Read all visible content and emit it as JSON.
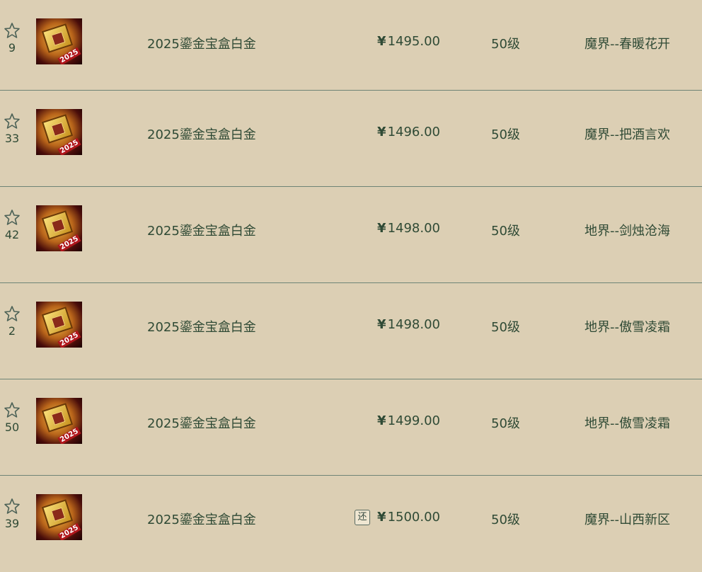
{
  "colors": {
    "background": "#dccfb4",
    "text": "#2f4a35",
    "divider": "#6f8476"
  },
  "listings": [
    {
      "fav_count": "9",
      "name": "2025鎏金宝盒白金",
      "currency": "¥",
      "price": "1495.00",
      "badge": "",
      "level": "50级",
      "server": "魔界--春暖花开",
      "thumb_year": "2025"
    },
    {
      "fav_count": "33",
      "name": "2025鎏金宝盒白金",
      "currency": "¥",
      "price": "1496.00",
      "badge": "",
      "level": "50级",
      "server": "魔界--把酒言欢",
      "thumb_year": "2025"
    },
    {
      "fav_count": "42",
      "name": "2025鎏金宝盒白金",
      "currency": "¥",
      "price": "1498.00",
      "badge": "",
      "level": "50级",
      "server": "地界--剑烛沧海",
      "thumb_year": "2025"
    },
    {
      "fav_count": "2",
      "name": "2025鎏金宝盒白金",
      "currency": "¥",
      "price": "1498.00",
      "badge": "",
      "level": "50级",
      "server": "地界--傲雪凌霜",
      "thumb_year": "2025"
    },
    {
      "fav_count": "50",
      "name": "2025鎏金宝盒白金",
      "currency": "¥",
      "price": "1499.00",
      "badge": "",
      "level": "50级",
      "server": "地界--傲雪凌霜",
      "thumb_year": "2025"
    },
    {
      "fav_count": "39",
      "name": "2025鎏金宝盒白金",
      "currency": "¥",
      "price": "1500.00",
      "badge": "还",
      "level": "50级",
      "server": "魔界--山西新区",
      "thumb_year": "2025"
    }
  ]
}
